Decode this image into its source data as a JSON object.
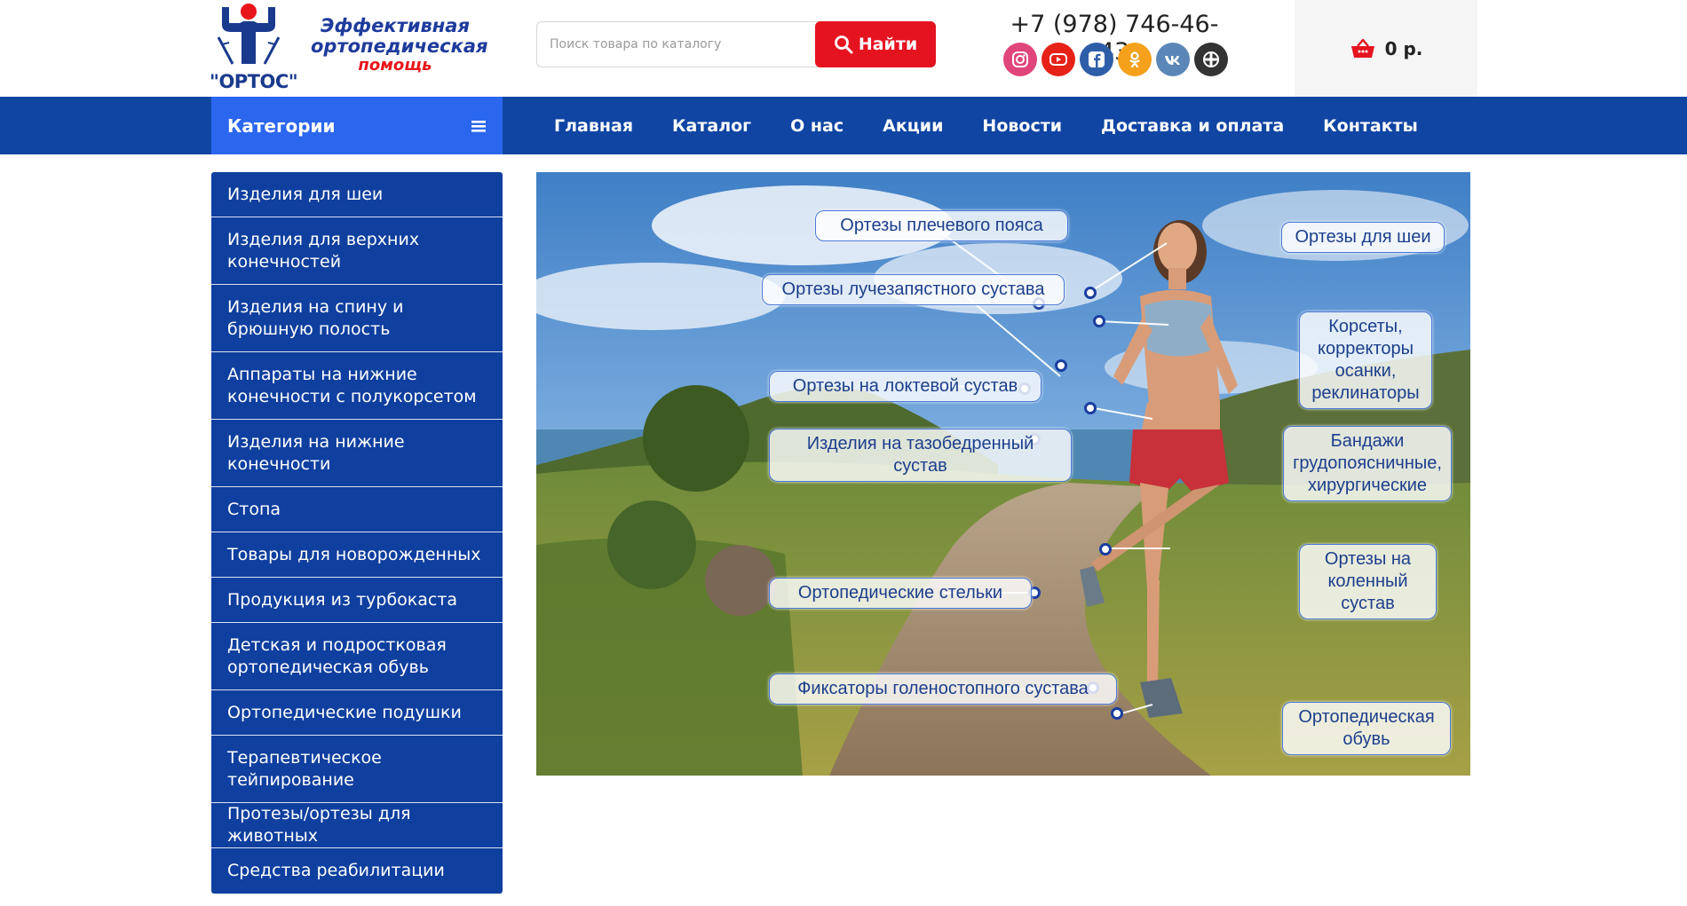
{
  "header": {
    "logo_text": "\"ОРТОС\"",
    "tagline_line1": "Эффективная",
    "tagline_line2": "ортопедическая",
    "tagline_line3": "помощь",
    "search_placeholder": "Поиск товара по каталогу",
    "search_button": "Найти",
    "phone": "+7 (978) 746-46-43",
    "socials": [
      "instagram-icon",
      "youtube-icon",
      "facebook-icon",
      "odnoklassniki-icon",
      "vk-icon",
      "other-social-icon"
    ],
    "cart_total": "0 р."
  },
  "nav": {
    "categories_label": "Категории",
    "items": [
      "Главная",
      "Каталог",
      "О нас",
      "Акции",
      "Новости",
      "Доставка и оплата",
      "Контакты"
    ]
  },
  "sidebar": {
    "items": [
      "Изделия для шеи",
      "Изделия для верхних конечностей",
      "Изделия на спину и брюшную полость",
      "Аппараты на нижние конечности с полукорсетом",
      "Изделия на нижние конечности",
      "Стопа",
      "Товары для новорожденных",
      "Продукция из турбокаста",
      "Детская и подростковая ортопедическая обувь",
      "Ортопедические подушки",
      "Терапевтическое тейпирование",
      "Протезы/ортезы для животных",
      "Средства реабилитации"
    ]
  },
  "hero": {
    "labels": [
      "Ортезы плечевого пояса",
      "Ортезы лучезапястного сустава",
      "Ортезы на локтевой сустав",
      "Изделия на тазобедренный сустав",
      "Ортопедические стельки",
      "Фиксаторы голеностопного сустава",
      "Ортезы для шеи",
      "Корсеты, корректоры осанки, реклинаторы",
      "Бандажи грудопоясничные, хирургические",
      "Ортезы на коленный сустав",
      "Ортопедическая обувь"
    ]
  },
  "colors": {
    "nav_blue": "#1045a3",
    "categories_blue": "#2b66ee",
    "sidebar_blue": "#0f3f9f",
    "accent_red": "#e51320"
  }
}
